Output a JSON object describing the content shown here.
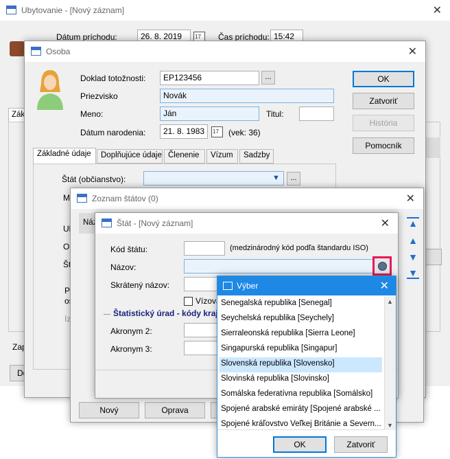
{
  "ubytovanie": {
    "title": "Ubytovanie - [Nový záznam]",
    "arrival_date_label": "Dátum príchodu:",
    "arrival_date_value": "26. 8. 2019",
    "arrival_time_label": "Čas príchodu:",
    "arrival_time_value": "15:42",
    "tab_partial": "Zák",
    "written_label": "Zapísal:",
    "documents_button": "Dokumenty a o"
  },
  "osoba": {
    "title": "Osoba",
    "id_doc_label": "Doklad totožnosti:",
    "id_doc_value": "EP123456",
    "browse_label": "...",
    "surname_label": "Priezvisko",
    "surname_value": "Novák",
    "name_label": "Meno:",
    "name_value": "Ján",
    "title_label": "Titul:",
    "title_value": "",
    "birth_label": "Dátum narodenia:",
    "birth_value": "21. 8. 1983",
    "age_text": "(vek: 36)",
    "buttons": {
      "ok": "OK",
      "close": "Zatvoriť",
      "history": "História",
      "helper": "Pomocník"
    },
    "tabs": [
      "Základné údaje",
      "Doplňujúce údaje",
      "Členenie",
      "Vízum",
      "Sadzby"
    ],
    "state_label": "Štát (občianstvo):",
    "state_value": "",
    "partial_mi": "Mi",
    "partial_ul": "Ul",
    "partial_ob": "Ob",
    "partial_st": "Št",
    "partial_pr": "Pr",
    "partial_os": "os",
    "partial_iz": "Iz"
  },
  "zoznam": {
    "title": "Zoznam štátov (0)",
    "col_partial": "Náz",
    "buttons": {
      "new": "Nový",
      "edit": "Oprava"
    }
  },
  "stat": {
    "title": "Štát - [Nový záznam]",
    "code_label": "Kód štátu:",
    "code_value": "",
    "code_hint": "(medzinárodný kód podľa štandardu ISO)",
    "name_label": "Názov:",
    "name_value": "",
    "short_label": "Skrátený názov:",
    "short_value": "",
    "visa_checkbox_label": "Vízova",
    "stat_section_title": "Štatistický úrad - kódy kraj",
    "acronym2_label": "Akronym 2:",
    "acronym2_value": "",
    "acronym3_label": "Akronym 3:",
    "acronym3_value": ""
  },
  "vyber": {
    "title": "Výber",
    "items": [
      "Senegalská republika [Senegal]",
      "Seychelská republika [Seychely]",
      "Sierraleonská republika [Sierra Leone]",
      "Singapurská republika [Singapur]",
      "Slovenská republika [Slovensko]",
      "Slovinská republika [Slovinsko]",
      "Somálska federatívna republika [Somálsko]",
      "Spojené arabské emiráty [Spojené arabské ...",
      "Spojené kráľovstvo Veľkej Británie a Severn..."
    ],
    "selected_index": 4,
    "buttons": {
      "ok": "OK",
      "close": "Zatvoriť"
    }
  },
  "colors": {
    "accent": "#0078d7",
    "selection": "#cce8ff",
    "highlight_frame": "#e8185a",
    "section_title": "#1a237e"
  }
}
